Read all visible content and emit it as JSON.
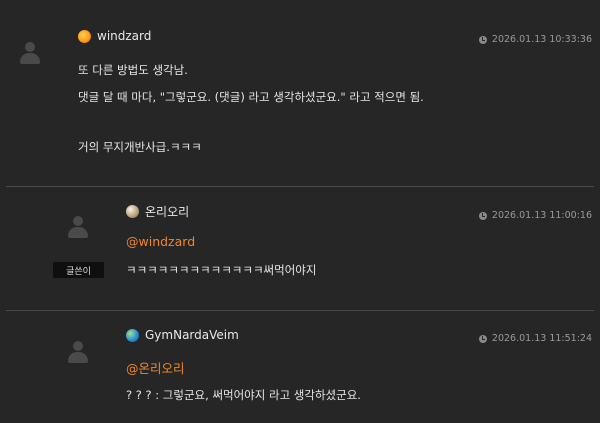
{
  "comments": [
    {
      "author": "windzard",
      "time": "2026.01.13 10:33:36",
      "lines": [
        "또 다른 방법도 생각남.",
        "댓글 달 때 마다, \"그렇군요. (댓글) 라고 생각하셨군요.\" 라고 적으면 됨.",
        "거의 무지개반사급.ㅋㅋㅋ"
      ]
    },
    {
      "author": "온리오리",
      "time": "2026.01.13 11:00:16",
      "badge": "글쓴이",
      "mention": "@windzard",
      "lines": [
        "ㅋㅋㅋㅋㅋㅋㅋㅋㅋㅋㅋㅋㅋ써먹어야지"
      ]
    },
    {
      "author": "GymNardaVeim",
      "time": "2026.01.13 11:51:24",
      "mention": "@온리오리",
      "lines": [
        "? ? ? : 그렇군요, 써먹어야지 라고 생각하셨군요."
      ]
    }
  ],
  "colors": {
    "background": "#262626",
    "mention": "#f0862d",
    "divider": "#4a4a4a"
  }
}
